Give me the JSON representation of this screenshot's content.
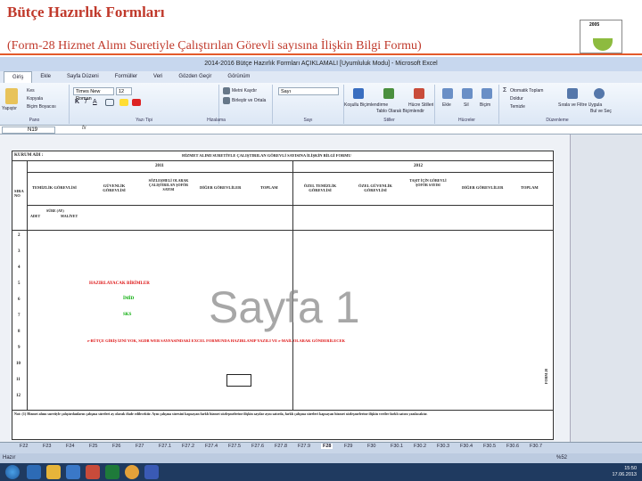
{
  "slide": {
    "title": "Bütçe Hazırlık Formları",
    "subtitle": "(Form-28 Hizmet Alımı Suretiyle Çalıştırılan Görevli sayısına İlişkin Bilgi Formu)",
    "logo_year": "2005"
  },
  "excel": {
    "window_title": "2014-2016 Bütçe Hazırlık Formları AÇIKLAMALI [Uyumluluk Modu] - Microsoft Excel",
    "tabs": [
      "Giriş",
      "Ekle",
      "Sayfa Düzeni",
      "Formüller",
      "Veri",
      "Gözden Geçir",
      "Görünüm"
    ],
    "font_name": "Times New Roman",
    "font_size": "12",
    "number_format": "Sayı",
    "ribbon": {
      "paste": "Yapıştır",
      "cut": "Kes",
      "copy": "Kopyala",
      "format_painter": "Biçim Boyacısı",
      "wrap_text": "Metni Kaydır",
      "merge": "Birleştir ve Ortala",
      "cond_format": "Koşullu Biçimlendirme",
      "table_format": "Tablo Olarak Biçimlendir",
      "cell_styles": "Hücre Stilleri",
      "insert": "Ekle",
      "delete": "Sil",
      "format": "Biçim",
      "autosum": "Otomatik Toplam",
      "fill": "Doldur",
      "clear": "Temizle",
      "sort_filter": "Sırala ve Filtre Uygula",
      "find_select": "Bul ve Seç",
      "groups": [
        "Pano",
        "Yazı Tipi",
        "Hizalama",
        "Sayı",
        "Stiller",
        "Hücreler",
        "Düzenleme"
      ]
    },
    "name_box": "N19",
    "fx": "fx",
    "status": "Hazır",
    "zoom": "%52",
    "sheet_tabs": [
      "F22",
      "F23",
      "F24",
      "F25",
      "F26",
      "F27",
      "F27.1",
      "F27.2",
      "F27.4",
      "F27.5",
      "F27.6",
      "F27.8",
      "F27.9",
      "F28",
      "F29",
      "F30",
      "F30.1",
      "F30.2",
      "F30.3",
      "F30.4",
      "F30.5",
      "F30.6",
      "F30.7"
    ],
    "clock_time": "15:50",
    "clock_date": "17.06.2013"
  },
  "form": {
    "kurum_adi": "KURUM ADI :",
    "header": "HİZMET ALIMI SURETİYLE ÇALIŞTIRILAN GÖREVLİ SAYISINA İLİŞKİN BİLGİ FORMU",
    "year_a": "2011",
    "year_b": "2012",
    "sira_no": "SIRA NO",
    "col_temizlik": "TEMİZLİK GÖREVLİSİ",
    "col_guvenlik": "GÜVENLİK GÖREVLİSİ",
    "col_sofor": "SÖZLEŞMELİ OLARAK ÇALIŞTIRILAN ŞOFÖR SAYISI",
    "col_diger": "DİĞER GÖREVLİLER",
    "col_toplam": "TOPLAM",
    "col_ozel_temizlik": "ÖZEL TEMİZLİK GÖREVLİSİ",
    "col_ozel_guvenlik": "ÖZEL GÜVENLİK GÖREVLİSİ",
    "col_sofor_b": "TAŞIT İÇİN GÖREVLİ ŞOFÖR SAYISI",
    "col_diger_b": "DİĞER GÖREVLİLER",
    "col_toplam_b": "TOPLAM",
    "sub_adet": "ADET",
    "sub_sure": "SÜRE (AY)",
    "sub_maliyet": "MALİYET",
    "row_numbers": [
      "1",
      "2",
      "3",
      "4",
      "5",
      "6",
      "7",
      "8",
      "9",
      "10",
      "11",
      "12"
    ],
    "note_title": "HAZIRLAYACAK BİRİMLER",
    "note_imid": "İMİD",
    "note_sks": "SKS",
    "note_long": "e-BÜTÇE GİRİŞ İZNİ YOK, SGDB WEB SAYFASINDAKİ EXCEL FORMUNDA HAZIRLANIP YAZILI VE e-MAİL OLARAK GÖNDERİLECEK",
    "footnote": "Not: (1) Hizmet alımı suretiyle çalıştırılanların çalışma süreleri ay olarak ifade edilecektir. Aynı çalışma süresini kapsayan farklı hizmet sözleşmelerine ilişkin sayılar aynı satırda, farklı çalışma süreleri kapsayan hizmet sözleşmelerine ilişkin veriler farklı satıra yazılacaktır.",
    "form_code": "FORM 28",
    "watermark": "Sayfa 1"
  }
}
